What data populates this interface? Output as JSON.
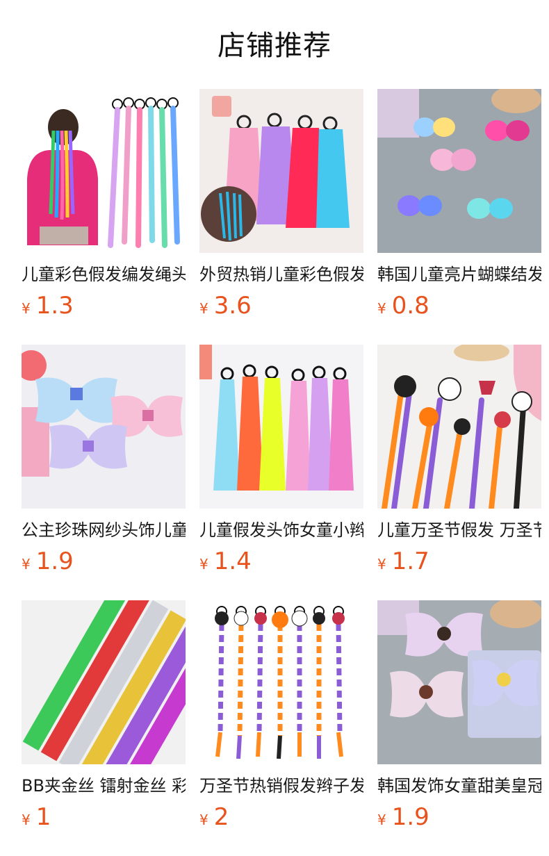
{
  "header": {
    "title": "店铺推荐"
  },
  "products": [
    {
      "name": "儿童彩色假发编发绳头绳",
      "currency": "¥",
      "price": "1.3",
      "image": "kids-rainbow-braided-wig-hair-ties"
    },
    {
      "name": "外贸热销儿童彩色假发辫子",
      "currency": "¥",
      "price": "3.6",
      "image": "colorful-braided-wig-ponytails"
    },
    {
      "name": "韩国儿童亮片蝴蝶结发夹",
      "currency": "¥",
      "price": "0.8",
      "image": "sequin-butterfly-hair-clips"
    },
    {
      "name": "公主珍珠网纱头饰儿童发夹",
      "currency": "¥",
      "price": "1.9",
      "image": "pearl-tulle-bow-clips"
    },
    {
      "name": "儿童假发头饰女童小辫子",
      "currency": "¥",
      "price": "1.4",
      "image": "neon-braided-wig-hair-ties"
    },
    {
      "name": "儿童万圣节假发 万圣节发夹",
      "currency": "¥",
      "price": "1.7",
      "image": "halloween-wig-clips"
    },
    {
      "name": "BB夹金丝 镭射金丝 彩色发片",
      "currency": "¥",
      "price": "1",
      "image": "tinsel-hair-extension-clips"
    },
    {
      "name": "万圣节热销假发辫子发绳",
      "currency": "¥",
      "price": "2",
      "image": "halloween-braided-wig-ties"
    },
    {
      "name": "韩国发饰女童甜美皇冠发夹",
      "currency": "¥",
      "price": "1.9",
      "image": "princess-tulle-bow-clips"
    }
  ]
}
